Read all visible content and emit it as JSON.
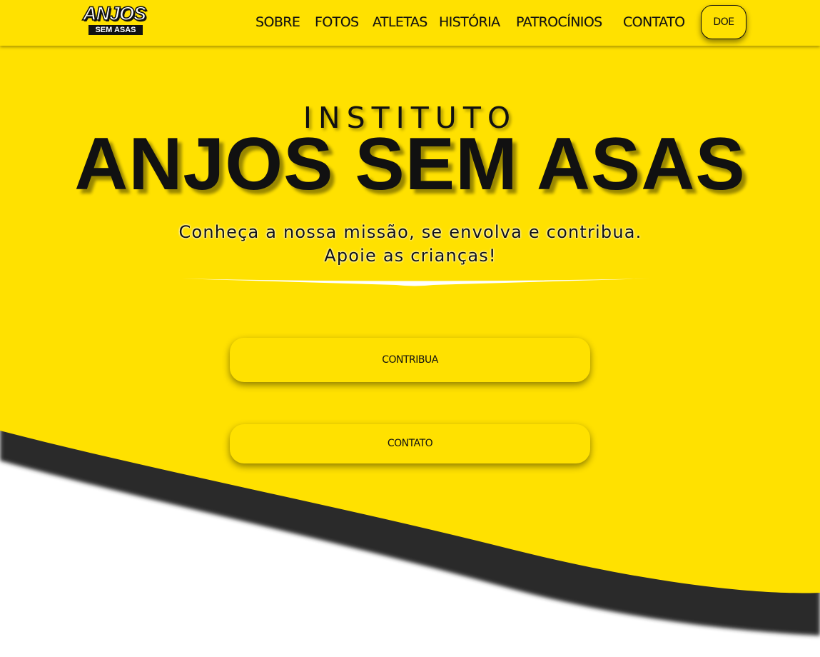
{
  "header": {
    "logo": {
      "line1": "ANJOS",
      "line2": "SEM ASAS"
    },
    "nav": {
      "sobre": "SOBRE",
      "fotos": "FOTOS",
      "atletas": "ATLETAS",
      "historia": "HISTÓRIA",
      "patrocinios": "PATROCÍNIOS",
      "contato": "CONTATO"
    },
    "doe_label": "DOE"
  },
  "hero": {
    "kicker": "INSTITUTO",
    "title": "ANJOS SEM ASAS",
    "subtitle": "Conheça a nossa missão, se envolva e contribua. Apoie as crianças!",
    "buttons": {
      "contribua": "CONTRIBUA",
      "contato": "CONTATO"
    }
  },
  "colors": {
    "brand_yellow": "#ffe100",
    "dark": "#111111",
    "wave_shadow": "#2a2a2a",
    "background": "#ffffff"
  }
}
